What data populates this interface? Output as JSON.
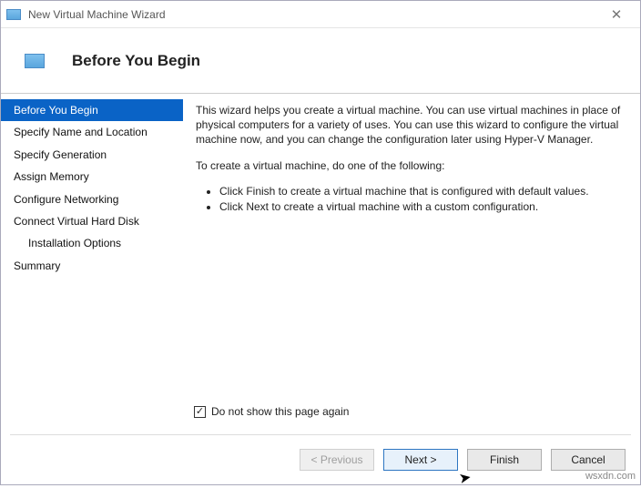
{
  "window": {
    "title": "New Virtual Machine Wizard"
  },
  "header": {
    "title": "Before You Begin"
  },
  "sidebar": {
    "items": [
      {
        "label": "Before You Begin",
        "selected": true
      },
      {
        "label": "Specify Name and Location"
      },
      {
        "label": "Specify Generation"
      },
      {
        "label": "Assign Memory"
      },
      {
        "label": "Configure Networking"
      },
      {
        "label": "Connect Virtual Hard Disk"
      },
      {
        "label": "Installation Options",
        "sub": true
      },
      {
        "label": "Summary"
      }
    ]
  },
  "content": {
    "intro": "This wizard helps you create a virtual machine. You can use virtual machines in place of physical computers for a variety of uses. You can use this wizard to configure the virtual machine now, and you can change the configuration later using Hyper-V Manager.",
    "prompt": "To create a virtual machine, do one of the following:",
    "bullets": [
      "Click Finish to create a virtual machine that is configured with default values.",
      "Click Next to create a virtual machine with a custom configuration."
    ],
    "checkbox_label": "Do not show this page again",
    "checkbox_checked": true
  },
  "footer": {
    "previous": "< Previous",
    "next": "Next >",
    "finish": "Finish",
    "cancel": "Cancel"
  },
  "watermark": "wsxdn.com"
}
